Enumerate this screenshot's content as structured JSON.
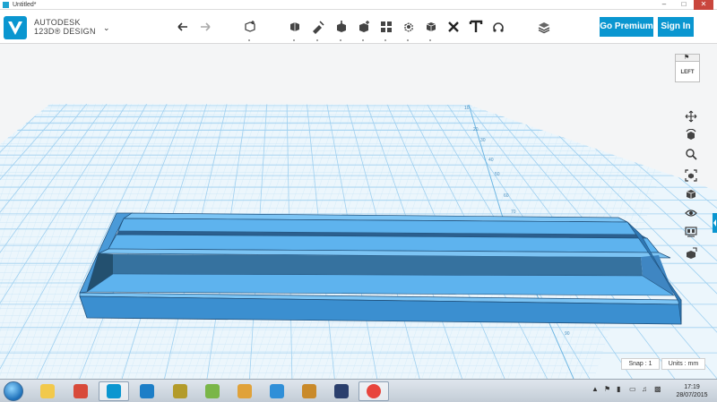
{
  "window": {
    "title": "Untitled*"
  },
  "brand": {
    "line1": "AUTODESK",
    "line2": "123D® DESIGN",
    "accent": "#0a96d0"
  },
  "toolbar": {
    "tools": [
      "undo-icon",
      "redo-icon",
      "primitives-icon",
      "sketch-icon",
      "construct-icon",
      "modify-icon",
      "pattern-icon",
      "grouping-icon",
      "combine-icon",
      "measure-icon",
      "text-icon",
      "snap-icon",
      "material-icon"
    ],
    "go_premium": "Go Premium",
    "sign_in": "Sign In"
  },
  "viewcube": {
    "face_label": "LEFT"
  },
  "nav_tools": [
    "pan-icon",
    "orbit-icon",
    "zoom-icon",
    "fit-icon",
    "view-mode-icon",
    "visibility-icon",
    "material-view-icon",
    "outliner-icon"
  ],
  "status": {
    "snap": "Snap : 1",
    "units": "Units : mm"
  },
  "grid": {
    "labels": [
      "10",
      "20",
      "30",
      "40",
      "50",
      "60",
      "70",
      "80",
      "90"
    ]
  },
  "colors": {
    "model_top": "#5eb3ee",
    "model_side": "#3b8fd0",
    "model_dark": "#2b5f8e",
    "grid": "#9fd0f0",
    "grid_bg": "#ecf6fc"
  },
  "taskbar": {
    "apps": [
      "file-explorer-icon",
      "sketchup-icon",
      "123d-design-icon",
      "ccleaner-icon",
      "app-yellow-icon",
      "bluestacks-icon",
      "picasa-icon",
      "teamviewer-icon",
      "app-orange-icon",
      "blender-icon",
      "chrome-icon"
    ],
    "time": "17:19",
    "date": "28/07/2015"
  }
}
